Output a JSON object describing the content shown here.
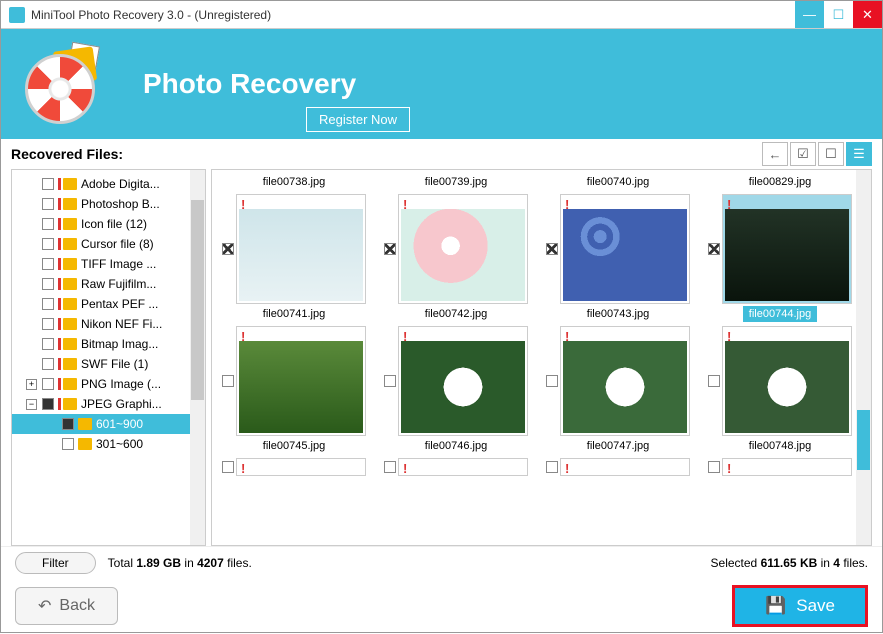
{
  "titlebar": {
    "title": "MiniTool Photo Recovery 3.0 - (Unregistered)"
  },
  "banner": {
    "title": "Photo Recovery",
    "register": "Register Now"
  },
  "sidebar": {
    "label": "Recovered Files:",
    "items": [
      {
        "label": "Adobe Digita...",
        "filled": false
      },
      {
        "label": "Photoshop B...",
        "filled": false
      },
      {
        "label": "Icon file (12)",
        "filled": false
      },
      {
        "label": "Cursor file (8)",
        "filled": false
      },
      {
        "label": "TIFF Image ...",
        "filled": false
      },
      {
        "label": "Raw Fujifilm...",
        "filled": false
      },
      {
        "label": "Pentax PEF ...",
        "filled": false
      },
      {
        "label": "Nikon NEF Fi...",
        "filled": false
      },
      {
        "label": "Bitmap Imag...",
        "filled": false
      },
      {
        "label": "SWF File (1)",
        "filled": false
      },
      {
        "label": "PNG Image (...",
        "filled": false
      },
      {
        "label": "JPEG Graphi...",
        "filled": true
      }
    ],
    "sub": [
      {
        "label": "601~900",
        "selected": true,
        "filled": true
      },
      {
        "label": "301~600",
        "selected": false,
        "filled": false
      }
    ]
  },
  "grid": {
    "row0": [
      {
        "name": "file00738.jpg"
      },
      {
        "name": "file00739.jpg"
      },
      {
        "name": "file00740.jpg"
      },
      {
        "name": "file00829.jpg"
      }
    ],
    "row1": [
      {
        "name": "file00741.jpg",
        "checked": true,
        "css": "background:linear-gradient(#cfe5ea,#e8f2f4);"
      },
      {
        "name": "file00742.jpg",
        "checked": true,
        "css": "background:radial-gradient(circle at 40% 40%,#fff 0 10%,#f7c7cd 10% 40%,#d8efe8 40%);"
      },
      {
        "name": "file00743.jpg",
        "checked": true,
        "css": "background:radial-gradient(circle at 30% 30%,#6a8fd6 0 6%,#4060b0 6% 12%,#6a8fd6 12% 18%,#4060b0 18%);"
      },
      {
        "name": "file00744.jpg",
        "checked": true,
        "selected": true,
        "css": "background:linear-gradient(#223326,#0a140c);"
      }
    ],
    "row2": [
      {
        "name": "file00745.jpg",
        "checked": false,
        "css": "background:linear-gradient(#5a8a3a,#2a5a1a);"
      },
      {
        "name": "file00746.jpg",
        "checked": false,
        "css": "background:radial-gradient(circle,#fff 0 25%,#2a5a2a 25%);"
      },
      {
        "name": "file00747.jpg",
        "checked": false,
        "css": "background:radial-gradient(circle,#fff 0 25%,#3a6a3a 25%);"
      },
      {
        "name": "file00748.jpg",
        "checked": false,
        "css": "background:radial-gradient(circle,#fff 0 25%,#355a35 25%);"
      }
    ]
  },
  "status": {
    "filter": "Filter",
    "total_pre": "Total ",
    "total_size": "1.89 GB",
    "total_mid": " in ",
    "total_count": "4207",
    "total_post": " files.",
    "sel_pre": "Selected ",
    "sel_size": "611.65 KB",
    "sel_mid": " in ",
    "sel_count": "4",
    "sel_post": " files."
  },
  "buttons": {
    "back": "Back",
    "save": "Save"
  }
}
